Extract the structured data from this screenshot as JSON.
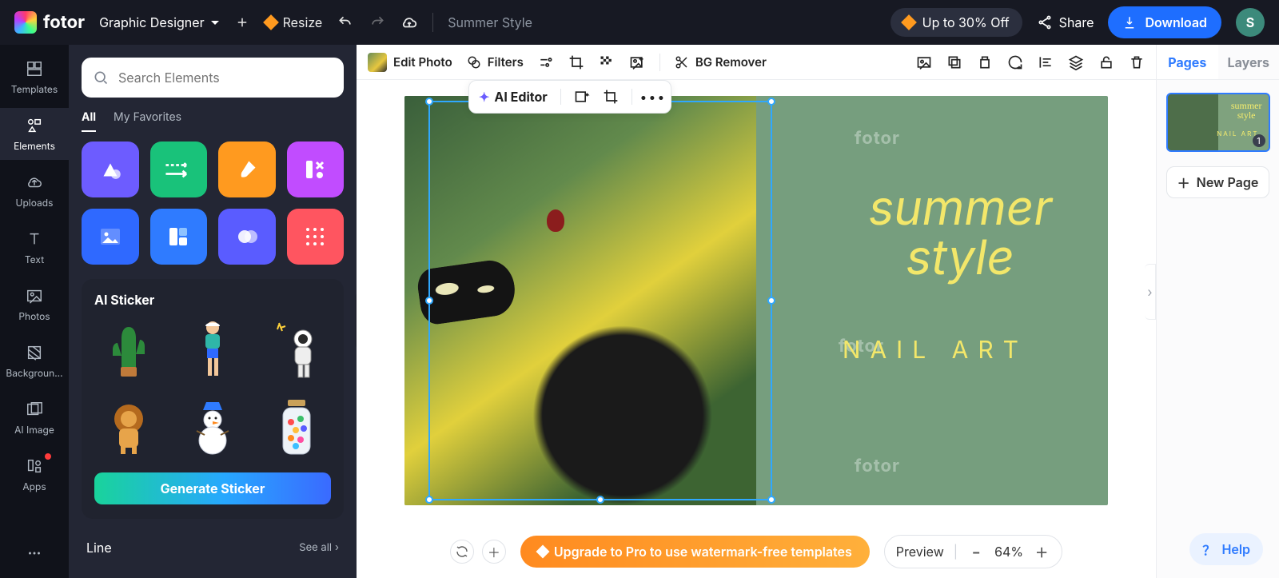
{
  "header": {
    "brand": "fotor",
    "mode": "Graphic Designer",
    "resize": "Resize",
    "doc_title": "Summer Style",
    "promo": "Up to 30% Off",
    "share": "Share",
    "download": "Download",
    "avatar": "S"
  },
  "rail": {
    "items": [
      {
        "label": "Templates"
      },
      {
        "label": "Elements"
      },
      {
        "label": "Uploads"
      },
      {
        "label": "Text"
      },
      {
        "label": "Photos"
      },
      {
        "label": "Backgroun..."
      },
      {
        "label": "AI Image"
      },
      {
        "label": "Apps"
      }
    ]
  },
  "side": {
    "search_placeholder": "Search Elements",
    "tabs": {
      "all": "All",
      "fav": "My Favorites"
    },
    "ai_section_title": "AI Sticker",
    "generate": "Generate Sticker",
    "section2_title": "Line",
    "see_all": "See all",
    "tile_colors": [
      "#6d5cff",
      "#19c27a",
      "#ff9a1f",
      "#c14cff",
      "#2f69ff",
      "#2f7bff",
      "#5a5cff",
      "#ff5560"
    ]
  },
  "toolbar": {
    "edit_photo": "Edit Photo",
    "filters": "Filters",
    "bg_remover": "BG Remover"
  },
  "context": {
    "ai_editor": "AI Editor"
  },
  "canvas": {
    "watermark": "fotor",
    "line1": "summer",
    "line2": "style",
    "line3": "NAIL ART"
  },
  "footer": {
    "upgrade": "Upgrade to Pro to use watermark-free templates",
    "preview": "Preview",
    "zoom": "64%"
  },
  "right": {
    "pages": "Pages",
    "layers": "Layers",
    "new_page": "New Page",
    "page_no": "1",
    "help": "Help"
  }
}
